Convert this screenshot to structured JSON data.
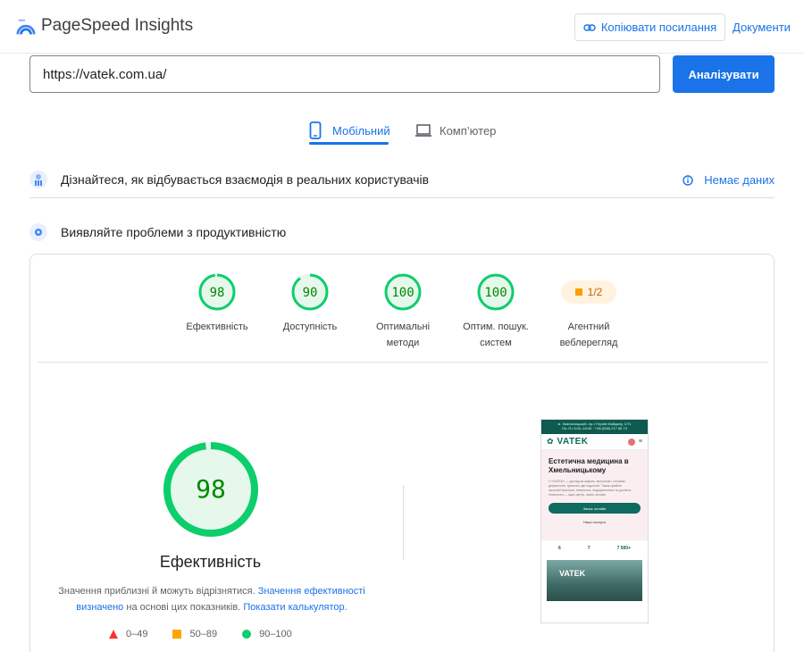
{
  "header": {
    "app_title": "PageSpeed Insights",
    "copy_link_label": "Копіювати посилання",
    "docs_label": "Документи"
  },
  "search": {
    "url_value": "https://vatek.com.ua/",
    "analyze_label": "Аналізувати"
  },
  "tabs": {
    "mobile_label": "Мобільний",
    "desktop_label": "Комп’ютер",
    "active": "mobile"
  },
  "crux": {
    "title": "Дізнайтеся, як відбувається взаємодія в реальних користувачів",
    "status": "Немає даних"
  },
  "diagnose": {
    "title": "Виявляйте проблеми з продуктивністю"
  },
  "scores": [
    {
      "value": "98",
      "label_line1": "Ефективність",
      "label_line2": ""
    },
    {
      "value": "90",
      "label_line1": "Доступність",
      "label_line2": ""
    },
    {
      "value": "100",
      "label_line1": "Оптимальні",
      "label_line2": "методи"
    },
    {
      "value": "100",
      "label_line1": "Оптим. пошук.",
      "label_line2": "систем"
    }
  ],
  "agent": {
    "value": "1/2",
    "label_line1": "Агентний",
    "label_line2": "веблерегляд"
  },
  "performance": {
    "score": "98",
    "title": "Ефективність",
    "disclaimer_1": "Значення приблизні й можуть відрізнятися.",
    "disclaimer_link_1": "Значення ефективності визначено",
    "disclaimer_2": "на основі цих показників.",
    "disclaimer_link_2": "Показати калькулятор."
  },
  "legend": {
    "fail": "0–49",
    "average": "50–89",
    "pass": "90–100"
  },
  "thumbnail": {
    "topbar_line1": "м. Хмельницький, пр-т Героїв Майдану, 17/1",
    "topbar_line2": "Пн–Пт 9:00–18:00 · +38 (098) 217 86 74",
    "logo": "VATEK",
    "headline": "Естетична медицина в Хмельницькому",
    "body": "У «VATEK» — догляд за шкірою, волоссям і стопами: дерматолог, трихолог, дві подологи. Також прийом гастроентеролога, гінеколога, ендокринолога та уролога-гінеколога — один центр, запис онлайн.",
    "cta_primary": "Запис онлайн",
    "cta_secondary": "Наші послуги",
    "stat_1": "6",
    "stat_2": "7",
    "stat_3": "7 500+",
    "photo_logo": "VATEK"
  },
  "colors": {
    "pass": "#0cce6b",
    "pass_text": "#008800",
    "pass_fill": "#e6f8ec",
    "average": "#ffa400",
    "fail": "#ff3333",
    "accent": "#1a73e8"
  }
}
